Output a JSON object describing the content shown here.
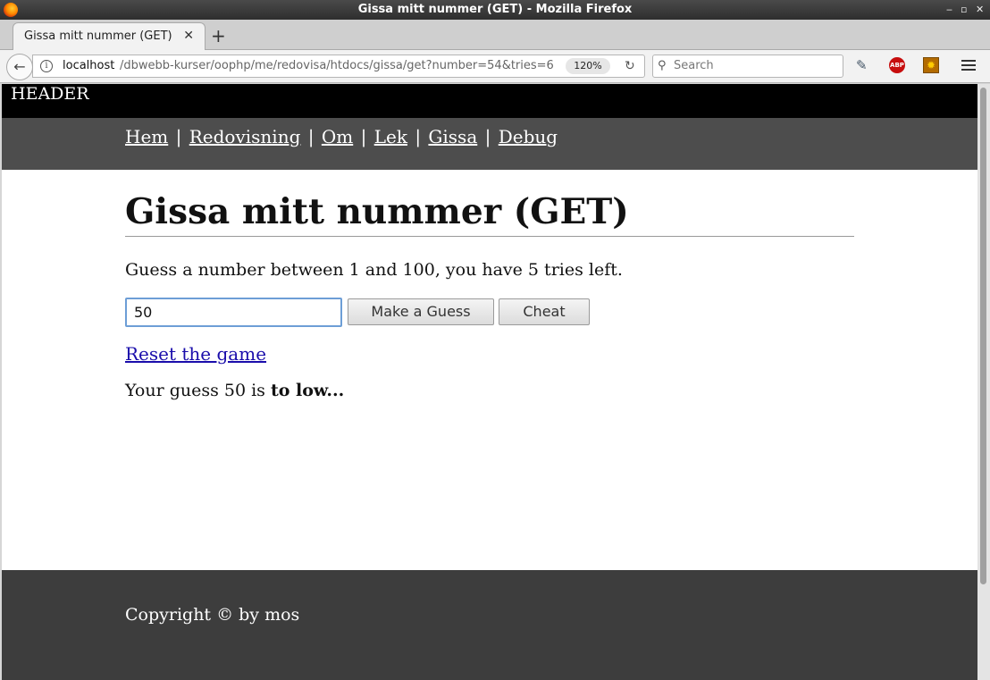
{
  "window": {
    "title": "Gissa mitt nummer (GET) - Mozilla Firefox",
    "controls": {
      "minimize": "‒",
      "maximize": "▫",
      "close": "✕"
    }
  },
  "tab": {
    "title": "Gissa mitt nummer (GET)",
    "close": "✕",
    "new": "+"
  },
  "nav": {
    "url_host": "localhost",
    "url_path": "/dbwebb-kurser/oophp/me/redovisa/htdocs/gissa/get?number=54&tries=6",
    "zoom": "120%",
    "search_placeholder": "Search",
    "abp_label": "ABP"
  },
  "page": {
    "header": "HEADER",
    "menu": [
      "Hem",
      "Redovisning",
      "Om",
      "Lek",
      "Gissa",
      "Debug"
    ],
    "menu_separator": "|",
    "title": "Gissa mitt nummer (GET)",
    "lead": "Guess a number between 1 and 100, you have 5 tries left.",
    "input_value": "50",
    "guess_button": "Make a Guess",
    "cheat_button": "Cheat",
    "reset_link": "Reset the game",
    "result_prefix": "Your guess 50 is",
    "result_bold": "to low...",
    "footer": "Copyright © by mos"
  }
}
